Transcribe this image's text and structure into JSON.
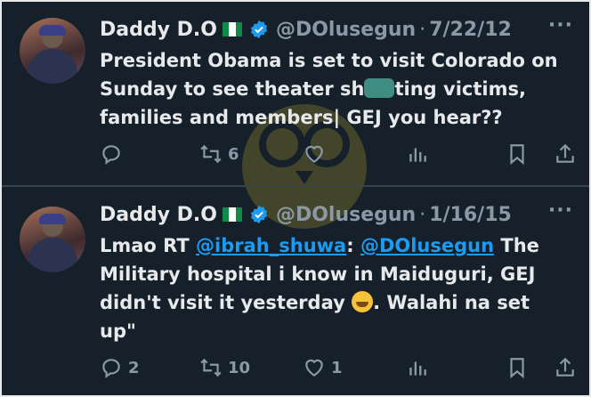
{
  "tweets": [
    {
      "display_name": "Daddy D.O",
      "handle": "@DOlusegun",
      "separator": "·",
      "date": "7/22/12",
      "text_parts": {
        "p1": "President Obama is set to visit Colorado on Sunday to see theater sh",
        "p2": "ting victims, families and members| GEJ you hear??"
      },
      "counts": {
        "replies": "",
        "retweets": "6",
        "likes": ""
      }
    },
    {
      "display_name": "Daddy D.O",
      "handle": "@DOlusegun",
      "separator": "·",
      "date": "1/16/15",
      "text_parts": {
        "p1": "Lmao RT ",
        "mention1": "@ibrah_shuwa",
        "p2": ": ",
        "mention2": "@DOlusegun",
        "p3": " The Military hospital i know in Maiduguri, GEJ didn't visit it yesterday ",
        "p4": ". Walahi na set up\""
      },
      "counts": {
        "replies": "2",
        "retweets": "10",
        "likes": "1"
      }
    }
  ],
  "more_label": "···",
  "colors": {
    "background": "#15202b",
    "text": "#e7e9ea",
    "secondary": "#8b98a5",
    "link": "#1d9bf0",
    "verified": "#1d9bf0",
    "flag_green": "#0f8a48"
  },
  "icons": [
    "reply-icon",
    "retweet-icon",
    "like-icon",
    "views-icon",
    "bookmark-icon",
    "share-icon",
    "verified-icon",
    "nigeria-flag-icon",
    "more-icon"
  ]
}
